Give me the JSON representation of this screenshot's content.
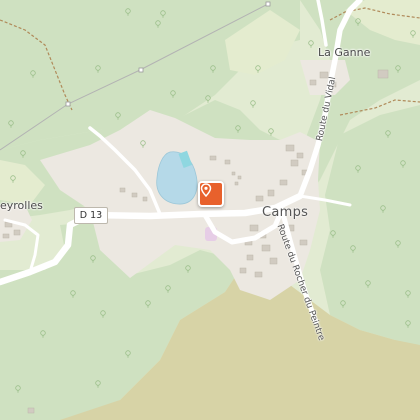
{
  "map": {
    "places": {
      "camps": "Camps",
      "la_ganne": "La Ganne",
      "peyrolles_partial": "eyrolles"
    },
    "roads": {
      "d13": "D 13",
      "route_du_vidal": "Route du Vidal",
      "route_du_rocher": "Route du Rocher du Peintre"
    },
    "marker": {
      "icon": "map-pin-icon",
      "color": "#e8612c"
    },
    "colors": {
      "forest": "#cfe1c1",
      "meadow": "#e1ead0",
      "village_area": "#ede9e2",
      "water": "#b7dbe9",
      "field": "#d6d2a5",
      "road": "#ffffff"
    }
  }
}
